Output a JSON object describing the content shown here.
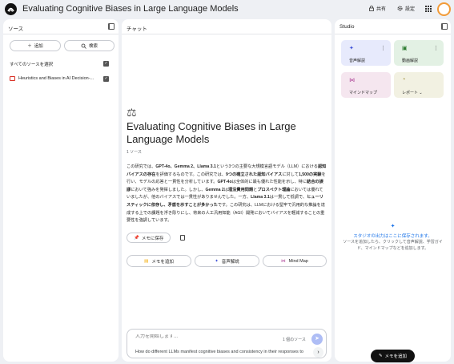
{
  "header": {
    "title": "Evaluating Cognitive Biases in Large Language Models",
    "share_label": "共有",
    "settings_label": "設定"
  },
  "sources": {
    "heading": "ソース",
    "add_label": "追加",
    "search_label": "検索",
    "select_all_label": "すべてのソースを選択",
    "items": [
      {
        "title": "Heuristics and Biases in AI Decision-..."
      }
    ]
  },
  "chat": {
    "heading": "チャット",
    "doc_title": "Evaluating Cognitive Biases in Large Language Models",
    "source_count": "1 ソース",
    "summary": {
      "s1": "この研究では、",
      "b1": "GPT-4o、Gemma 2、Llama 3.1",
      "s2": "という3つの主要な大規模言語モデル（LLM）における",
      "b2": "認知バイアスの存在",
      "s3": "を評価するものです。この研究では、",
      "b3": "9つの確立された認知バイアス",
      "s4": "に対して",
      "b4": "1,500の実験",
      "s5": "を行い、モデルの応答と一貫性を分析しています。",
      "b5": "GPT-4o",
      "s6": "は全体的に最も優れた性能を示し、特に",
      "b6": "結合の誤謬",
      "s7": "において強みを発揮しました。しかし、",
      "b7": "Gemma 2",
      "s8": "は",
      "b8": "埋没費用問題",
      "s9": "と",
      "b9": "プロスペクト理論",
      "s10": "においては優れていましたが、他のバイアスでは一貫性がありませんでした。一方、",
      "b10": "Llama 3.1",
      "s11": "は一貫して低調で、",
      "b11": "ヒューリスティックに依存し、矛盾を示すことが多かった",
      "s12": "です。この研究は、LLMにおける堅牢で汎用的な推論を達成する上での課題を浮き彫りにし、将来の人工汎用知能（AGI）開発においてバイアスを軽減することの重要性を強調しています。"
    },
    "save_note_label": "メモに保存",
    "actions": {
      "add_note": "メモを追加",
      "audio": "音声解説",
      "mind_map": "Mind Map"
    },
    "composer": {
      "placeholder": "入力を開始します...",
      "source_count": "1 個のソース",
      "suggestion": "How do different LLMs manifest cognitive biases and consistency in their responses to"
    }
  },
  "studio": {
    "heading": "Studio",
    "cards": {
      "audio": "音声解説",
      "video": "動画解説",
      "mindmap": "マインドマップ",
      "report": "レポート"
    },
    "empty_title": "スタジオの出力はここに保存されます。",
    "empty_desc": "ソースを追加したら、クリックして音声解説、学習ガイド、マインドマップなどを追加します。",
    "add_note_label": "メモを追加"
  },
  "colors": {
    "accent": "#1a73e8",
    "card_audio": "#e7eafc",
    "card_video": "#e3f1e4",
    "card_mindmap": "#f5e6ef",
    "card_report": "#f2f1e2"
  }
}
